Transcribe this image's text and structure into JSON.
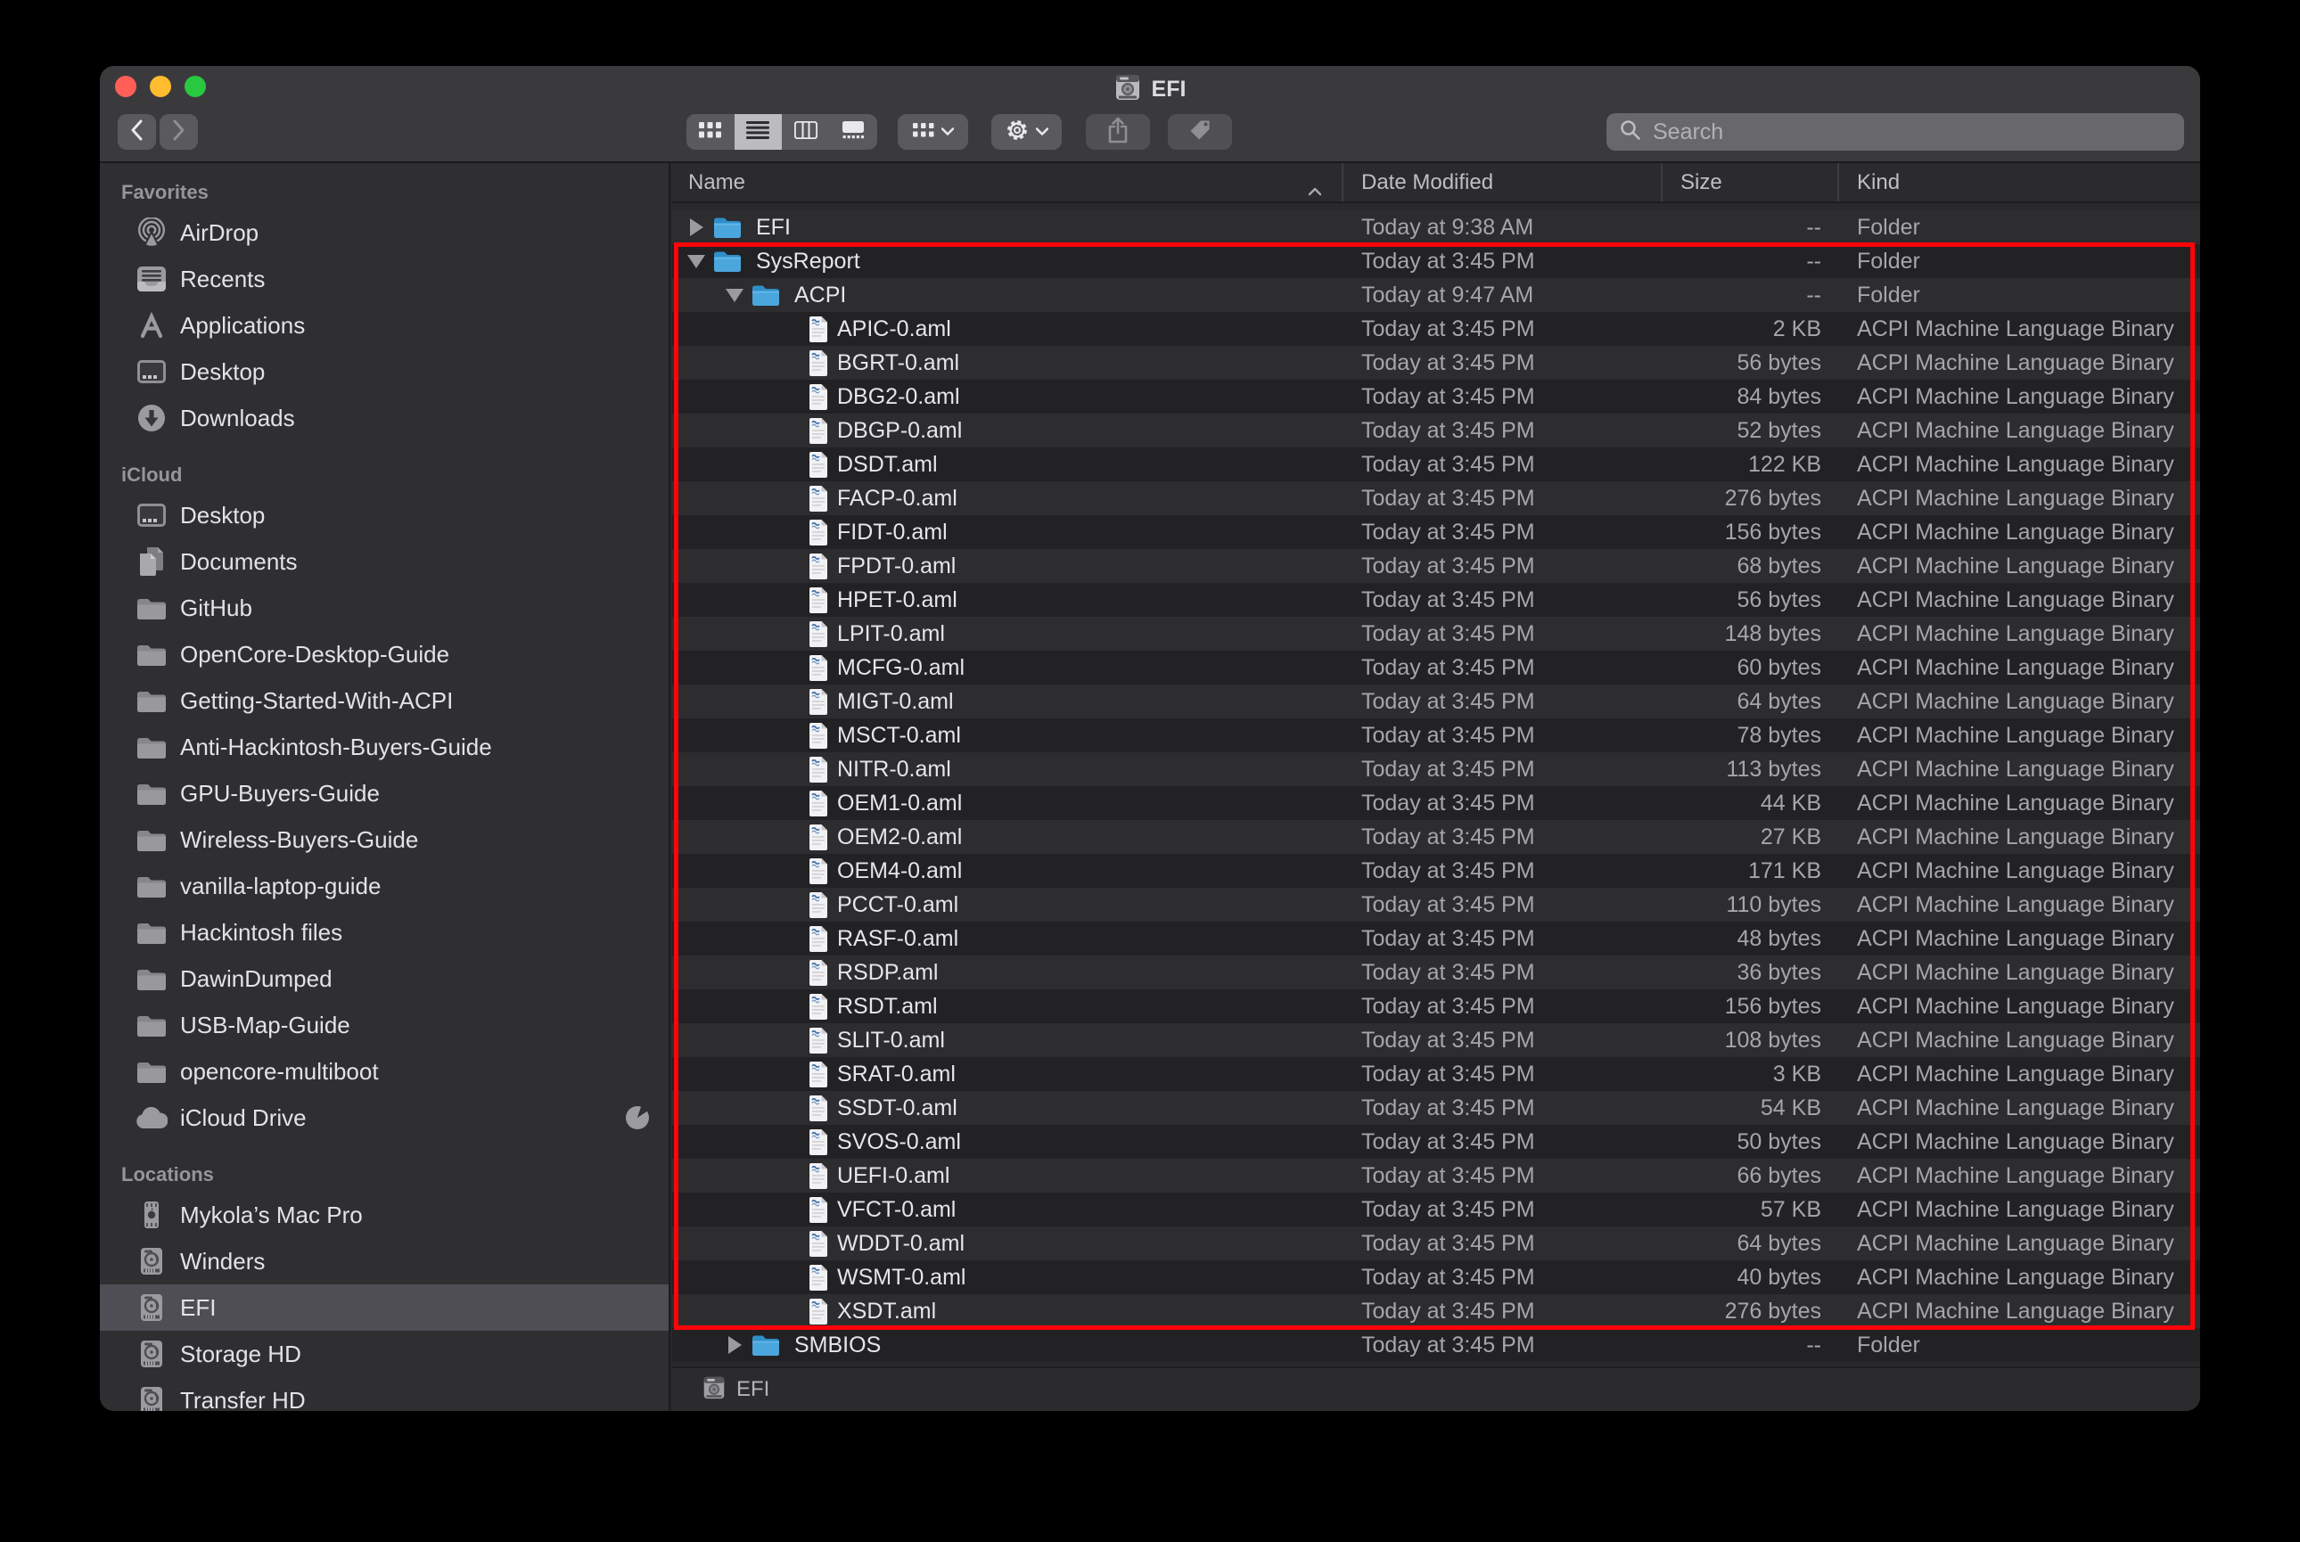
{
  "window": {
    "title": "EFI"
  },
  "toolbar": {
    "search_placeholder": "Search"
  },
  "columns": {
    "name": "Name",
    "date": "Date Modified",
    "size": "Size",
    "kind": "Kind"
  },
  "sidebar": {
    "sections": [
      {
        "label": "Favorites",
        "items": [
          {
            "label": "AirDrop",
            "icon": "airdrop"
          },
          {
            "label": "Recents",
            "icon": "recents"
          },
          {
            "label": "Applications",
            "icon": "applications"
          },
          {
            "label": "Desktop",
            "icon": "desktop"
          },
          {
            "label": "Downloads",
            "icon": "downloads"
          }
        ]
      },
      {
        "label": "iCloud",
        "items": [
          {
            "label": "Desktop",
            "icon": "desktop"
          },
          {
            "label": "Documents",
            "icon": "documents"
          },
          {
            "label": "GitHub",
            "icon": "folder"
          },
          {
            "label": "OpenCore-Desktop-Guide",
            "icon": "folder"
          },
          {
            "label": "Getting-Started-With-ACPI",
            "icon": "folder"
          },
          {
            "label": "Anti-Hackintosh-Buyers-Guide",
            "icon": "folder"
          },
          {
            "label": "GPU-Buyers-Guide",
            "icon": "folder"
          },
          {
            "label": "Wireless-Buyers-Guide",
            "icon": "folder"
          },
          {
            "label": "vanilla-laptop-guide",
            "icon": "folder"
          },
          {
            "label": "Hackintosh files",
            "icon": "folder"
          },
          {
            "label": "DawinDumped",
            "icon": "folder"
          },
          {
            "label": "USB-Map-Guide",
            "icon": "folder"
          },
          {
            "label": "opencore-multiboot",
            "icon": "folder"
          },
          {
            "label": "iCloud Drive",
            "icon": "cloud",
            "badge": "pie"
          }
        ]
      },
      {
        "label": "Locations",
        "items": [
          {
            "label": "Mykola’s Mac Pro",
            "icon": "macpro"
          },
          {
            "label": "Winders",
            "icon": "drive"
          },
          {
            "label": "EFI",
            "icon": "drive",
            "selected": true
          },
          {
            "label": "Storage HD",
            "icon": "drive"
          },
          {
            "label": "Transfer HD",
            "icon": "drive"
          }
        ]
      }
    ]
  },
  "rows": [
    {
      "name": "EFI",
      "date": "Today at 9:38 AM",
      "size": "--",
      "kind": "Folder",
      "depth": 0,
      "type": "folder",
      "disclosure": "collapsed"
    },
    {
      "name": "SysReport",
      "date": "Today at 3:45 PM",
      "size": "--",
      "kind": "Folder",
      "depth": 0,
      "type": "folder",
      "disclosure": "expanded"
    },
    {
      "name": "ACPI",
      "date": "Today at 9:47 AM",
      "size": "--",
      "kind": "Folder",
      "depth": 1,
      "type": "folder",
      "disclosure": "expanded"
    },
    {
      "name": "APIC-0.aml",
      "date": "Today at 3:45 PM",
      "size": "2 KB",
      "kind": "ACPI Machine Language Binary",
      "depth": 2,
      "type": "file"
    },
    {
      "name": "BGRT-0.aml",
      "date": "Today at 3:45 PM",
      "size": "56 bytes",
      "kind": "ACPI Machine Language Binary",
      "depth": 2,
      "type": "file"
    },
    {
      "name": "DBG2-0.aml",
      "date": "Today at 3:45 PM",
      "size": "84 bytes",
      "kind": "ACPI Machine Language Binary",
      "depth": 2,
      "type": "file"
    },
    {
      "name": "DBGP-0.aml",
      "date": "Today at 3:45 PM",
      "size": "52 bytes",
      "kind": "ACPI Machine Language Binary",
      "depth": 2,
      "type": "file"
    },
    {
      "name": "DSDT.aml",
      "date": "Today at 3:45 PM",
      "size": "122 KB",
      "kind": "ACPI Machine Language Binary",
      "depth": 2,
      "type": "file"
    },
    {
      "name": "FACP-0.aml",
      "date": "Today at 3:45 PM",
      "size": "276 bytes",
      "kind": "ACPI Machine Language Binary",
      "depth": 2,
      "type": "file"
    },
    {
      "name": "FIDT-0.aml",
      "date": "Today at 3:45 PM",
      "size": "156 bytes",
      "kind": "ACPI Machine Language Binary",
      "depth": 2,
      "type": "file"
    },
    {
      "name": "FPDT-0.aml",
      "date": "Today at 3:45 PM",
      "size": "68 bytes",
      "kind": "ACPI Machine Language Binary",
      "depth": 2,
      "type": "file"
    },
    {
      "name": "HPET-0.aml",
      "date": "Today at 3:45 PM",
      "size": "56 bytes",
      "kind": "ACPI Machine Language Binary",
      "depth": 2,
      "type": "file"
    },
    {
      "name": "LPIT-0.aml",
      "date": "Today at 3:45 PM",
      "size": "148 bytes",
      "kind": "ACPI Machine Language Binary",
      "depth": 2,
      "type": "file"
    },
    {
      "name": "MCFG-0.aml",
      "date": "Today at 3:45 PM",
      "size": "60 bytes",
      "kind": "ACPI Machine Language Binary",
      "depth": 2,
      "type": "file"
    },
    {
      "name": "MIGT-0.aml",
      "date": "Today at 3:45 PM",
      "size": "64 bytes",
      "kind": "ACPI Machine Language Binary",
      "depth": 2,
      "type": "file"
    },
    {
      "name": "MSCT-0.aml",
      "date": "Today at 3:45 PM",
      "size": "78 bytes",
      "kind": "ACPI Machine Language Binary",
      "depth": 2,
      "type": "file"
    },
    {
      "name": "NITR-0.aml",
      "date": "Today at 3:45 PM",
      "size": "113 bytes",
      "kind": "ACPI Machine Language Binary",
      "depth": 2,
      "type": "file"
    },
    {
      "name": "OEM1-0.aml",
      "date": "Today at 3:45 PM",
      "size": "44 KB",
      "kind": "ACPI Machine Language Binary",
      "depth": 2,
      "type": "file"
    },
    {
      "name": "OEM2-0.aml",
      "date": "Today at 3:45 PM",
      "size": "27 KB",
      "kind": "ACPI Machine Language Binary",
      "depth": 2,
      "type": "file"
    },
    {
      "name": "OEM4-0.aml",
      "date": "Today at 3:45 PM",
      "size": "171 KB",
      "kind": "ACPI Machine Language Binary",
      "depth": 2,
      "type": "file"
    },
    {
      "name": "PCCT-0.aml",
      "date": "Today at 3:45 PM",
      "size": "110 bytes",
      "kind": "ACPI Machine Language Binary",
      "depth": 2,
      "type": "file"
    },
    {
      "name": "RASF-0.aml",
      "date": "Today at 3:45 PM",
      "size": "48 bytes",
      "kind": "ACPI Machine Language Binary",
      "depth": 2,
      "type": "file"
    },
    {
      "name": "RSDP.aml",
      "date": "Today at 3:45 PM",
      "size": "36 bytes",
      "kind": "ACPI Machine Language Binary",
      "depth": 2,
      "type": "file"
    },
    {
      "name": "RSDT.aml",
      "date": "Today at 3:45 PM",
      "size": "156 bytes",
      "kind": "ACPI Machine Language Binary",
      "depth": 2,
      "type": "file"
    },
    {
      "name": "SLIT-0.aml",
      "date": "Today at 3:45 PM",
      "size": "108 bytes",
      "kind": "ACPI Machine Language Binary",
      "depth": 2,
      "type": "file"
    },
    {
      "name": "SRAT-0.aml",
      "date": "Today at 3:45 PM",
      "size": "3 KB",
      "kind": "ACPI Machine Language Binary",
      "depth": 2,
      "type": "file"
    },
    {
      "name": "SSDT-0.aml",
      "date": "Today at 3:45 PM",
      "size": "54 KB",
      "kind": "ACPI Machine Language Binary",
      "depth": 2,
      "type": "file"
    },
    {
      "name": "SVOS-0.aml",
      "date": "Today at 3:45 PM",
      "size": "50 bytes",
      "kind": "ACPI Machine Language Binary",
      "depth": 2,
      "type": "file"
    },
    {
      "name": "UEFI-0.aml",
      "date": "Today at 3:45 PM",
      "size": "66 bytes",
      "kind": "ACPI Machine Language Binary",
      "depth": 2,
      "type": "file"
    },
    {
      "name": "VFCT-0.aml",
      "date": "Today at 3:45 PM",
      "size": "57 KB",
      "kind": "ACPI Machine Language Binary",
      "depth": 2,
      "type": "file"
    },
    {
      "name": "WDDT-0.aml",
      "date": "Today at 3:45 PM",
      "size": "64 bytes",
      "kind": "ACPI Machine Language Binary",
      "depth": 2,
      "type": "file"
    },
    {
      "name": "WSMT-0.aml",
      "date": "Today at 3:45 PM",
      "size": "40 bytes",
      "kind": "ACPI Machine Language Binary",
      "depth": 2,
      "type": "file"
    },
    {
      "name": "XSDT.aml",
      "date": "Today at 3:45 PM",
      "size": "276 bytes",
      "kind": "ACPI Machine Language Binary",
      "depth": 2,
      "type": "file"
    },
    {
      "name": "SMBIOS",
      "date": "Today at 3:45 PM",
      "size": "--",
      "kind": "Folder",
      "depth": 1,
      "type": "folder",
      "disclosure": "collapsed"
    }
  ],
  "statusbar": {
    "label": "EFI"
  },
  "annotation": {
    "color": "#ff0409"
  }
}
